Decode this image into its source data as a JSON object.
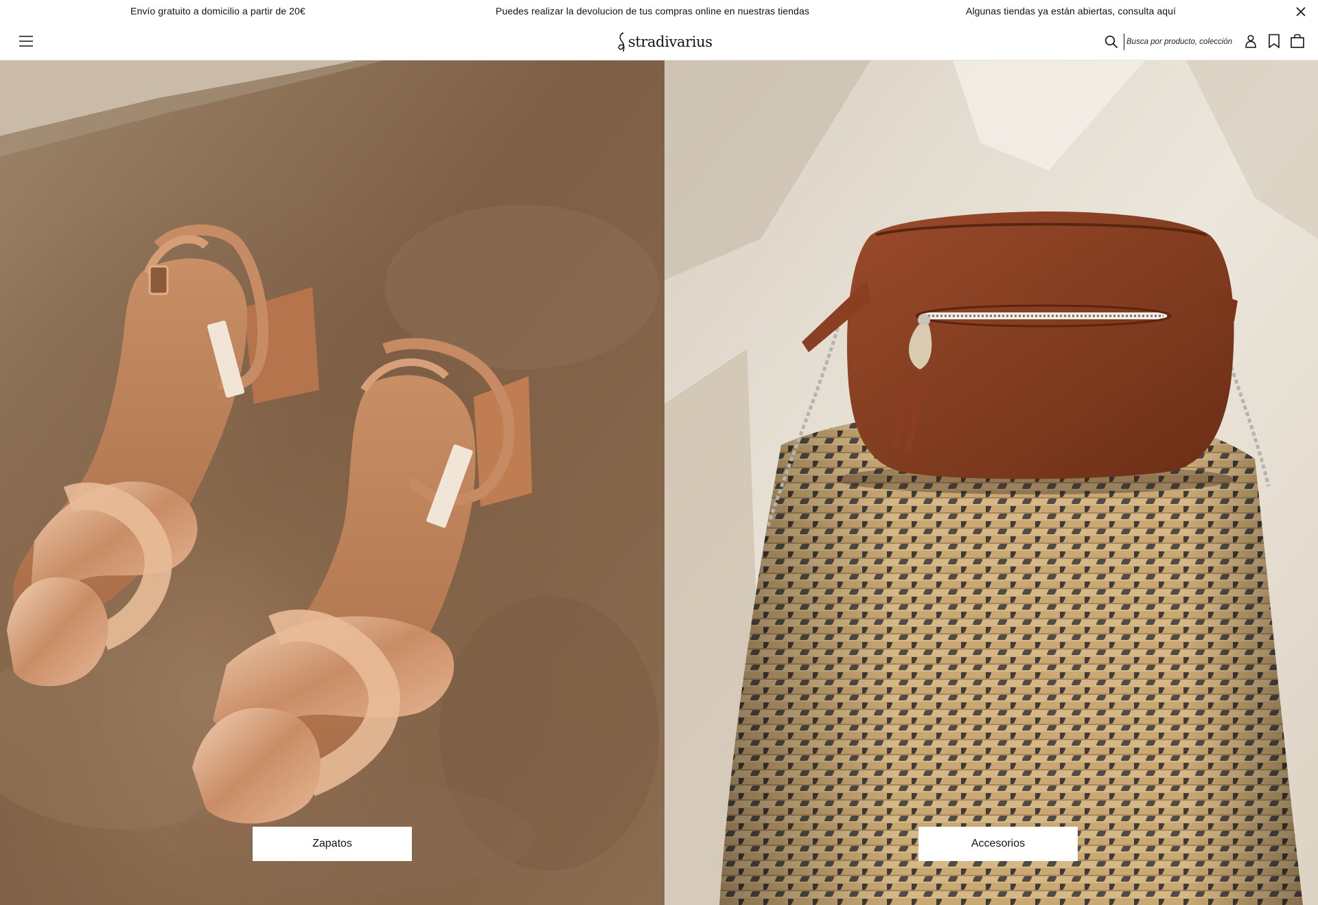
{
  "announcements": {
    "items": [
      "Envío gratuito a domicilio a partir de 20€",
      "Puedes realizar la devolucion de tus compras online en nuestras tiendas",
      "Algunas tiendas ya están abiertas, consulta aquí"
    ]
  },
  "header": {
    "logo_text": "stradivarius",
    "search": {
      "placeholder": "Busca por producto, colección..."
    }
  },
  "panels": [
    {
      "category_label": "Zapatos"
    },
    {
      "category_label": "Accesorios"
    }
  ],
  "colors": {
    "floor": "#8a6a4e",
    "wall": "#e8e1d5",
    "bag": "#8a3e22",
    "sandal": "#d9a47c",
    "basket": "#c9a874"
  },
  "icons": [
    "close-icon",
    "menu-icon",
    "search-icon",
    "user-icon",
    "bookmark-icon",
    "bag-icon"
  ]
}
